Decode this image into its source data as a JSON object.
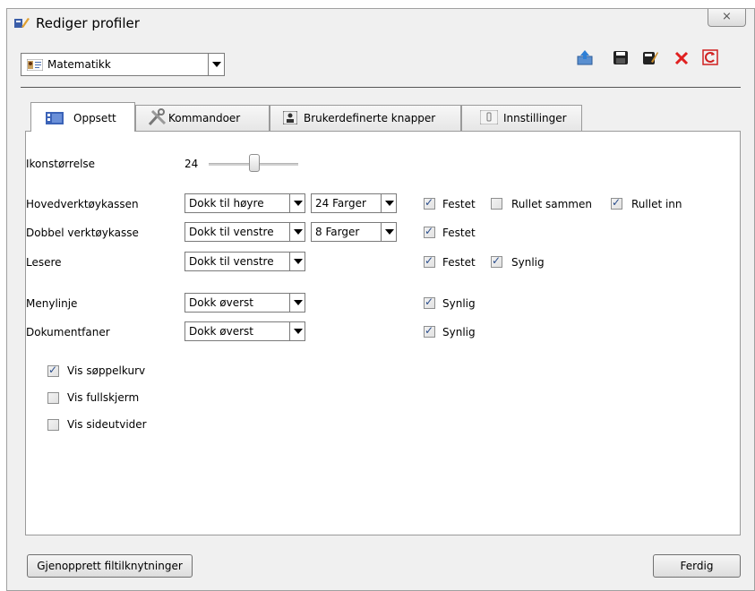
{
  "window": {
    "title": "Rediger profiler",
    "close_glyph": "⨯"
  },
  "profile": {
    "selected": "Matematikk"
  },
  "toolbar": [
    "export-icon",
    "save-icon",
    "rename-icon",
    "delete-icon",
    "refresh-icon"
  ],
  "tabs": [
    {
      "label": "Oppsett",
      "active": true
    },
    {
      "label": "Kommandoer"
    },
    {
      "label": "Brukerdefinerte knapper"
    },
    {
      "label": "Innstillinger"
    }
  ],
  "settings": {
    "icon_size_label": "Ikonstørrelse",
    "icon_size_value": "24",
    "main_toolbox": {
      "label": "Hovedverktøykassen",
      "position": "Dokk til høyre",
      "colors": "24 Farger",
      "fixed": "Festet",
      "collapsed": "Rullet sammen",
      "rolled_in": "Rullet inn"
    },
    "double_toolbox": {
      "label": "Dobbel verktøykasse",
      "position": "Dokk til venstre",
      "colors": "8 Farger",
      "fixed": "Festet"
    },
    "readers": {
      "label": "Lesere",
      "position": "Dokk til venstre",
      "fixed": "Festet",
      "visible": "Synlig"
    },
    "menubar": {
      "label": "Menylinje",
      "position": "Dokk øverst",
      "visible": "Synlig"
    },
    "doctabs": {
      "label": "Dokumentfaner",
      "position": "Dokk øverst",
      "visible": "Synlig"
    },
    "show_trash": "Vis søppelkurv",
    "show_fullscreen": "Vis fullskjerm",
    "show_page_expander": "Vis sideutvider"
  },
  "buttons": {
    "restore": "Gjenopprett filtilknytninger",
    "done": "Ferdig"
  }
}
